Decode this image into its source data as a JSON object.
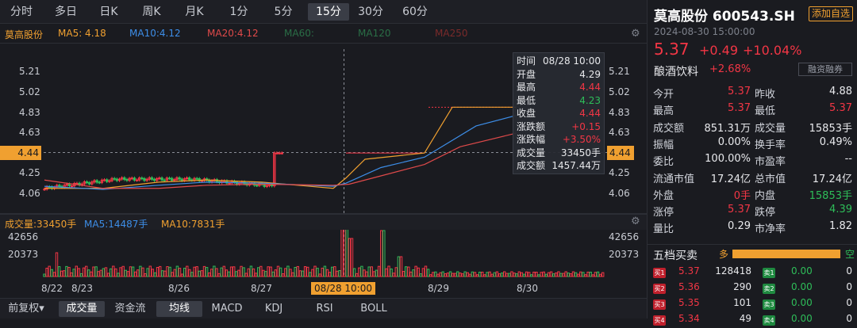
{
  "periods": [
    "分时",
    "多日",
    "日K",
    "周K",
    "月K",
    "1分",
    "5分",
    "15分",
    "30分",
    "60分"
  ],
  "active_period": "15分",
  "ma": {
    "name": "莫高股份",
    "ma5": "MA5: 4.18",
    "ma10": "MA10:4.12",
    "ma20": "MA20:4.12",
    "ma60": "MA60:",
    "ma120": "MA120",
    "ma250": "MA250"
  },
  "y_labels": [
    "5.21",
    "5.02",
    "4.83",
    "4.63",
    "4.44",
    "4.25",
    "4.06"
  ],
  "y_highlight": "4.44",
  "vol": {
    "label": "成交量:33450手",
    "ma5": "MA5:14487手",
    "ma10": "MA10:7831手",
    "y_labels": [
      "42656",
      "20373"
    ]
  },
  "x_labels": [
    "8/22",
    "8/23",
    "8/26",
    "8/27",
    "08/28 10:00",
    "8/29",
    "8/30"
  ],
  "tooltip": {
    "rows": [
      {
        "k": "时间",
        "v": "08/28 10:00",
        "c": "white"
      },
      {
        "k": "开盘",
        "v": "4.29",
        "c": "white"
      },
      {
        "k": "最高",
        "v": "4.44",
        "c": "red"
      },
      {
        "k": "最低",
        "v": "4.23",
        "c": "green"
      },
      {
        "k": "收盘",
        "v": "4.44",
        "c": "red"
      },
      {
        "k": "涨跌额",
        "v": "+0.15",
        "c": "red"
      },
      {
        "k": "涨跌幅",
        "v": "+3.50%",
        "c": "red"
      },
      {
        "k": "成交量",
        "v": "33450手",
        "c": "white"
      },
      {
        "k": "成交额",
        "v": "1457.44万",
        "c": "white"
      }
    ]
  },
  "bottom_tabs": [
    "前复权▾",
    "成交量",
    "资金流",
    "均线",
    "MACD",
    "KDJ",
    "RSI",
    "BOLL"
  ],
  "bottom_active": [
    "成交量",
    "均线"
  ],
  "stock": {
    "title": "莫高股份 600543.SH",
    "add_btn": "添加自选",
    "time": "2024-08-30 15:00:00",
    "price": "5.37",
    "change": "+0.49",
    "pct": "+10.04%",
    "sector": "酿酒饮料",
    "sector_pct": "+2.68%",
    "rz": "融资融券"
  },
  "stats": [
    {
      "k1": "今开",
      "v1": "5.37",
      "c1": "red",
      "k2": "昨收",
      "v2": "4.88",
      "c2": "white"
    },
    {
      "k1": "最高",
      "v1": "5.37",
      "c1": "red",
      "k2": "最低",
      "v2": "5.37",
      "c2": "red"
    },
    {
      "k1": "成交额",
      "v1": "851.31万",
      "c1": "white",
      "k2": "成交量",
      "v2": "15853手",
      "c2": "white"
    },
    {
      "k1": "振幅",
      "v1": "0.00%",
      "c1": "white",
      "k2": "换手率",
      "v2": "0.49%",
      "c2": "white"
    },
    {
      "k1": "委比",
      "v1": "100.00%",
      "c1": "white",
      "k2": "市盈率",
      "v2": "--",
      "c2": "white"
    },
    {
      "k1": "流通市值",
      "v1": "17.24亿",
      "c1": "white",
      "k2": "总市值",
      "v2": "17.24亿",
      "c2": "white"
    },
    {
      "k1": "外盘",
      "v1": "0手",
      "c1": "red",
      "k2": "内盘",
      "v2": "15853手",
      "c2": "green"
    },
    {
      "k1": "涨停",
      "v1": "5.37",
      "c1": "red",
      "k2": "跌停",
      "v2": "4.39",
      "c2": "green"
    },
    {
      "k1": "量比",
      "v1": "0.29",
      "c1": "white",
      "k2": "市净率",
      "v2": "1.82",
      "c2": "white"
    }
  ],
  "five_level": {
    "label": "五档买卖",
    "duo": "多",
    "kong": "空"
  },
  "orders": [
    {
      "tag": "买1",
      "p": "5.37",
      "q": "128418",
      "tag2": "卖1",
      "p2": "0.00",
      "q2": "0"
    },
    {
      "tag": "买2",
      "p": "5.36",
      "q": "290",
      "tag2": "卖2",
      "p2": "0.00",
      "q2": "0"
    },
    {
      "tag": "买3",
      "p": "5.35",
      "q": "101",
      "tag2": "卖3",
      "p2": "0.00",
      "q2": "0"
    },
    {
      "tag": "买4",
      "p": "5.34",
      "q": "49",
      "tag2": "卖4",
      "p2": "0.00",
      "q2": "0"
    }
  ],
  "colors": {
    "up": "#f23645",
    "down": "#2ebd59",
    "ma5": "#f0a030",
    "ma10": "#3d8ee8",
    "ma20": "#e04a4a",
    "accent": "#f0a030"
  }
}
